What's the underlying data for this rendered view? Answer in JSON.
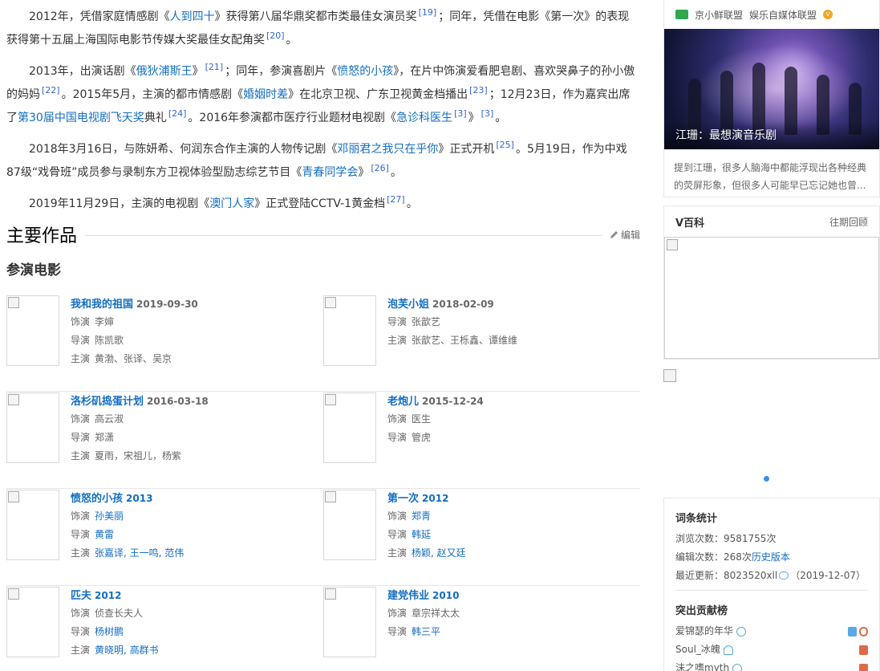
{
  "career": {
    "p1": {
      "a": "2012年，凭借家庭情感剧《",
      "l1": "人到四十",
      "b": "》获得第八届华鼎奖都市类最佳女演员奖",
      "r1": "[19]",
      "c": "；同年，凭借在电影《第一次》的表现获得第十五届上海国际电影节传媒大奖最佳女配角奖",
      "r2": "[20]",
      "d": "。"
    },
    "p2": {
      "a": "2013年，出演话剧《",
      "l1": "俄狄浦斯王",
      "b": "》",
      "r1": "[21]",
      "c": "；同年，参演喜剧片《",
      "l2": "愤怒的小孩",
      "d": "》，在片中饰演爱看肥皂剧、喜欢哭鼻子的孙小傲的妈妈",
      "r2": "[22]",
      "e": "。2015年5月，主演的都市情感剧《",
      "l3": "婚姻时差",
      "f": "》在北京卫视、广东卫视黄金档播出",
      "r3": "[23]",
      "g": "；12月23日，作为嘉宾出席了",
      "l4": "第30届中国电视剧飞天奖",
      "h": "典礼",
      "r4": "[24]",
      "i": "。2016年参演都市医疗行业题材电视剧《",
      "l5": "急诊科医生",
      "r5": "[3]",
      "j": "》",
      "r6": "[3]",
      "k": "。"
    },
    "p3": {
      "a": "2018年3月16日，与陈妍希、何润东合作主演的人物传记剧《",
      "l1": "邓丽君之我只在乎你",
      "b": "》正式开机",
      "r1": "[25]",
      "c": "。5月19日，作为中戏87级“戏骨班”成员参与录制东方卫视体验型励志综艺节目《",
      "l2": "青春同学会",
      "d": "》",
      "r2": "[26]",
      "e": "。"
    },
    "p4": {
      "a": "2019年11月29日，主演的电视剧《",
      "l1": "澳门人家",
      "b": "》正式登陆CCTV-1黄金档",
      "r1": "[27]",
      "c": "。"
    }
  },
  "works": {
    "title": "主要作品",
    "edit": "编辑",
    "subtitle": "参演电影"
  },
  "films": [
    [
      {
        "title": "我和我的祖国",
        "date": "2019-09-30",
        "lines": [
          [
            "饰演",
            "李婶"
          ],
          [
            "导演",
            "陈凯歌"
          ],
          [
            "主演",
            "黄渤、张译、吴京"
          ]
        ]
      },
      {
        "title": "泡芙小姐",
        "date": "2018-02-09",
        "lines": [
          [
            "导演",
            "张歆艺"
          ],
          [
            "主演",
            "张歆艺、王栎鑫、谭维维"
          ]
        ]
      }
    ],
    [
      {
        "title": "洛杉矶捣蛋计划",
        "date": "2016-03-18",
        "lines": [
          [
            "饰演",
            "高云淑"
          ],
          [
            "导演",
            "郑潇"
          ],
          [
            "主演",
            "夏雨，宋祖儿，杨紫"
          ]
        ]
      },
      {
        "title": "老炮儿",
        "date": "2015-12-24",
        "lines": [
          [
            "饰演",
            "医生"
          ],
          [
            "导演",
            "管虎"
          ]
        ]
      }
    ],
    [
      {
        "title": "愤怒的小孩",
        "date": "2013",
        "lines": [
          [
            "饰演",
            "孙美丽"
          ],
          [
            "导演",
            "黄雷"
          ],
          [
            "主演",
            "张嘉译, 王一鸣, 范伟"
          ]
        ]
      },
      {
        "title": "第一次",
        "date": "2012",
        "lines": [
          [
            "饰演",
            "郑青"
          ],
          [
            "导演",
            "韩延"
          ],
          [
            "主演",
            "杨颖, 赵又廷"
          ]
        ]
      }
    ],
    [
      {
        "title": "匹夫",
        "date": "2012",
        "lines": [
          [
            "饰演",
            "侦查长夫人"
          ],
          [
            "导演",
            "杨树鹏"
          ],
          [
            "主演",
            "黄晓明, 高群书"
          ]
        ]
      },
      {
        "title": "建党伟业",
        "date": "2010",
        "lines": [
          [
            "饰演",
            "章宗祥太太"
          ],
          [
            "导演",
            "韩三平"
          ]
        ]
      }
    ]
  ],
  "sidebar": {
    "source_a": "京小鲜联盟",
    "source_b": "娱乐自媒体联盟",
    "feature_caption": "江珊：最想演音乐剧",
    "feature_desc": "提到江珊，很多人脑海中都能浮现出各种经典的荧屏形象，但很多人可能早已忘记她也曾...",
    "vbaike_title": "V百科",
    "vbaike_more": "往期回顾",
    "stats_title": "词条统计",
    "views": "浏览次数：9581755次",
    "edits_prefix": "编辑次数：268次",
    "edits_link": "历史版本",
    "updated_prefix": "最近更新：",
    "updated_user": "8023520xll",
    "updated_date": "（2019-12-07）",
    "contrib_title": "突出贡献榜",
    "contributors": [
      "爱锦瑟的年华",
      "Soul_冰魄",
      "沫之嗜myth"
    ]
  }
}
